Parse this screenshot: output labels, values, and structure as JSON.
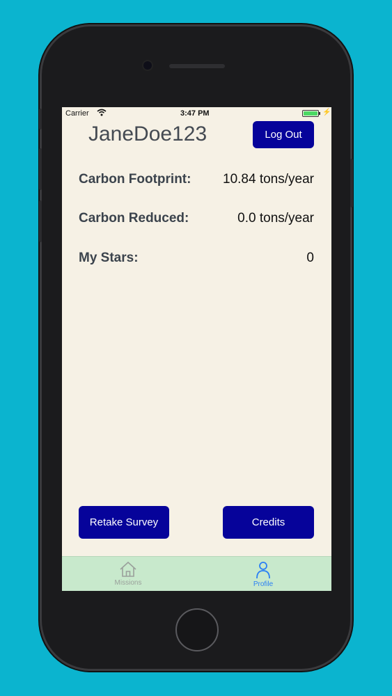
{
  "status_bar": {
    "carrier": "Carrier",
    "time": "3:47 PM",
    "battery_level": 1.0
  },
  "header": {
    "username": "JaneDoe123",
    "logout_label": "Log Out"
  },
  "stats": [
    {
      "label": "Carbon Footprint:",
      "value": "10.84 tons/year"
    },
    {
      "label": "Carbon Reduced:",
      "value": "0.0 tons/year"
    },
    {
      "label": "My Stars:",
      "value": "0"
    }
  ],
  "actions": {
    "retake_label": "Retake Survey",
    "credits_label": "Credits"
  },
  "tab_bar": {
    "tabs": [
      {
        "label": "Missions",
        "icon": "home-icon",
        "selected": false
      },
      {
        "label": "Profile",
        "icon": "person-icon",
        "selected": true
      }
    ]
  },
  "colors": {
    "background": "#0bb4cf",
    "screen": "#f6f1e5",
    "button": "#06039a",
    "tab_bar": "#c8e9cc",
    "tab_active": "#2a7ff5"
  }
}
